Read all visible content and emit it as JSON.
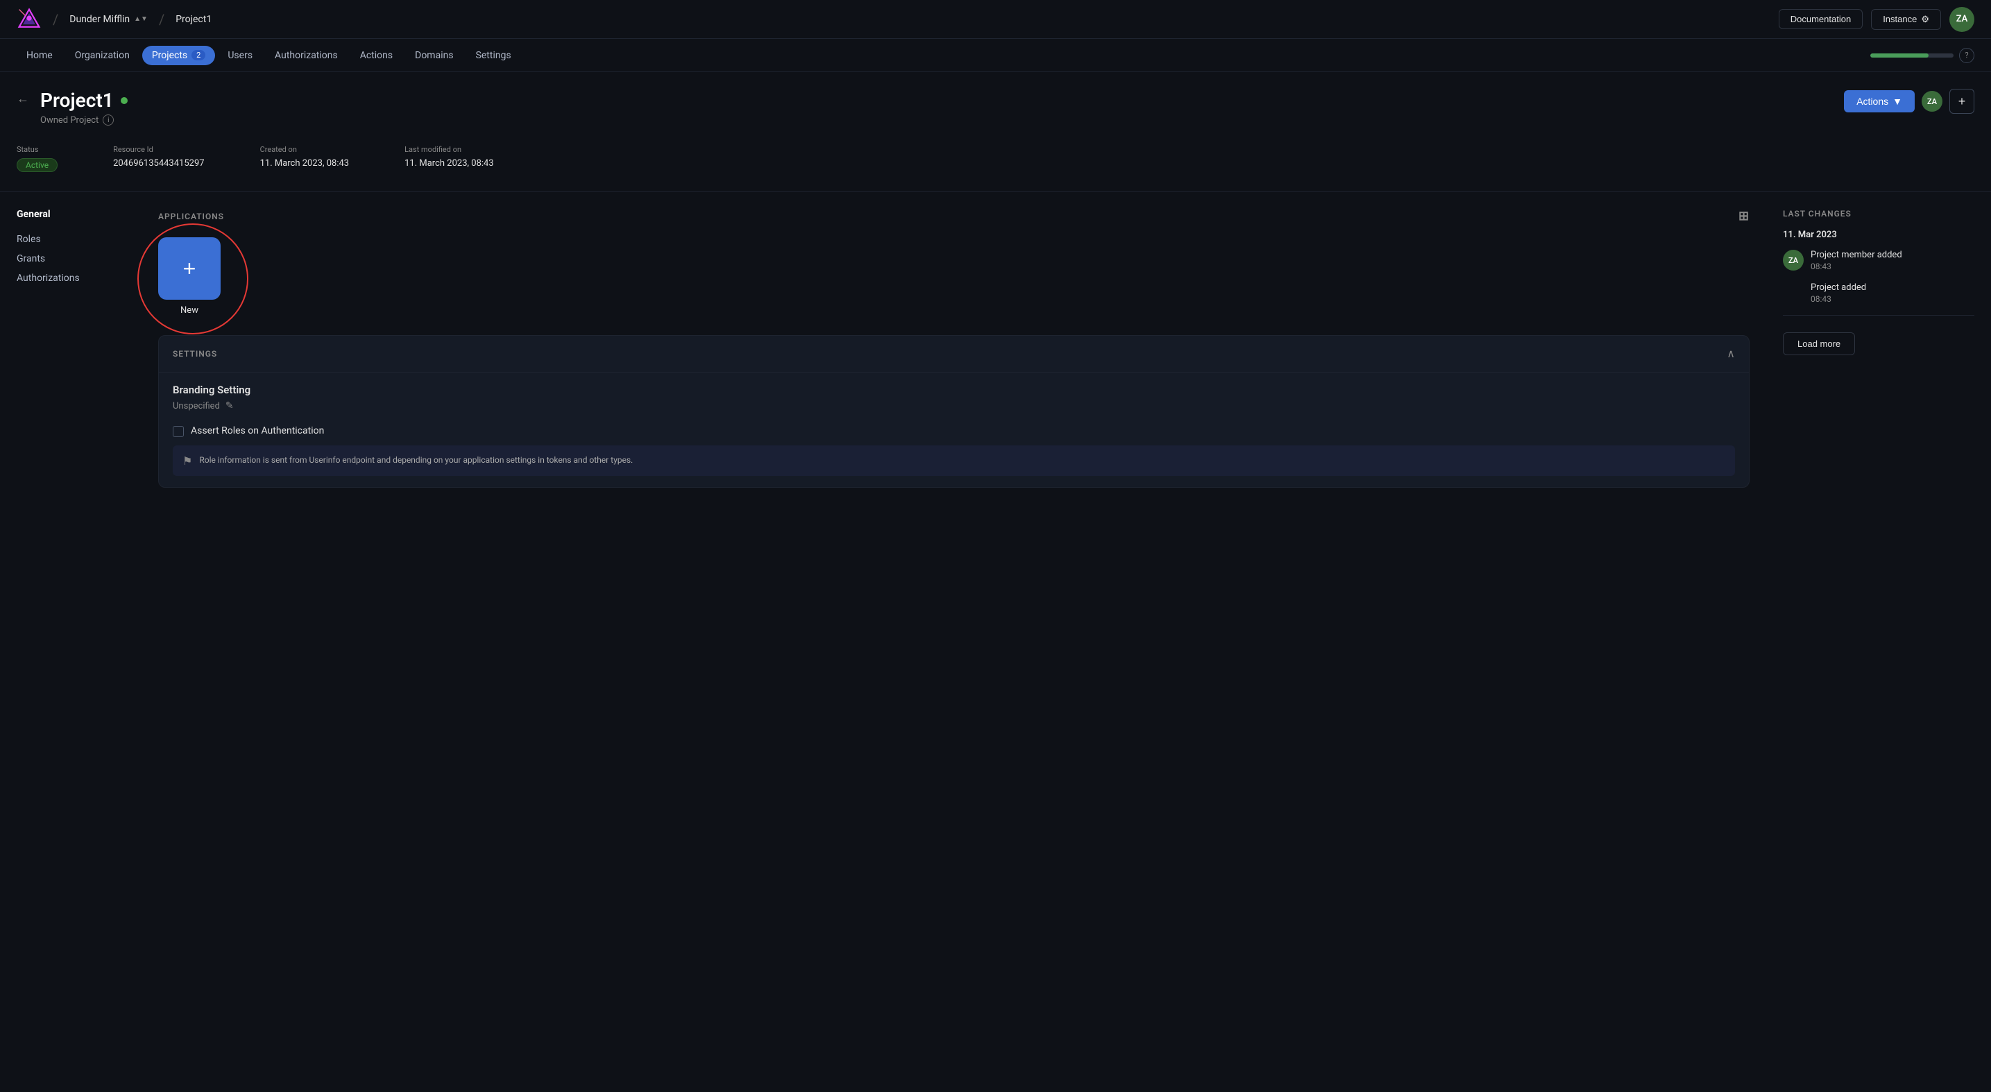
{
  "topNav": {
    "orgName": "Dunder Mifflin",
    "projectName": "Project1",
    "docButtonLabel": "Documentation",
    "instanceButtonLabel": "Instance",
    "avatarInitials": "ZA"
  },
  "secondNav": {
    "links": [
      {
        "label": "Home",
        "active": false
      },
      {
        "label": "Organization",
        "active": false
      },
      {
        "label": "Projects",
        "active": true,
        "badge": "2"
      },
      {
        "label": "Users",
        "active": false
      },
      {
        "label": "Authorizations",
        "active": false
      },
      {
        "label": "Actions",
        "active": false
      },
      {
        "label": "Domains",
        "active": false
      },
      {
        "label": "Settings",
        "active": false
      }
    ]
  },
  "projectHeader": {
    "title": "Project1",
    "ownedLabel": "Owned Project",
    "actionsLabel": "Actions",
    "avatarInitials": "ZA"
  },
  "statusRow": {
    "statusLabel": "Status",
    "statusValue": "Active",
    "resourceIdLabel": "Resource Id",
    "resourceIdValue": "204696135443415297",
    "createdOnLabel": "Created on",
    "createdOnValue": "11. March 2023, 08:43",
    "lastModifiedLabel": "Last modified on",
    "lastModifiedValue": "11. March 2023, 08:43"
  },
  "sidebar": {
    "sectionTitle": "General",
    "items": [
      {
        "label": "Roles"
      },
      {
        "label": "Grants"
      },
      {
        "label": "Authorizations"
      }
    ]
  },
  "applications": {
    "sectionTitle": "APPLICATIONS",
    "newLabel": "New"
  },
  "settings": {
    "sectionTitle": "SETTINGS",
    "brandingSettingLabel": "Branding Setting",
    "unspecifiedText": "Unspecified",
    "assertRolesLabel": "Assert Roles on Authentication",
    "infoBoxText": "Role information is sent from Userinfo endpoint and depending on your application settings in tokens and other types."
  },
  "lastChanges": {
    "sectionTitle": "LAST CHANGES",
    "dateLabel": "11. Mar 2023",
    "changes": [
      {
        "avatarInitials": "ZA",
        "action": "Project member added",
        "time": "08:43"
      },
      {
        "action": "Project added",
        "time": "08:43"
      }
    ],
    "loadMoreLabel": "Load more"
  }
}
